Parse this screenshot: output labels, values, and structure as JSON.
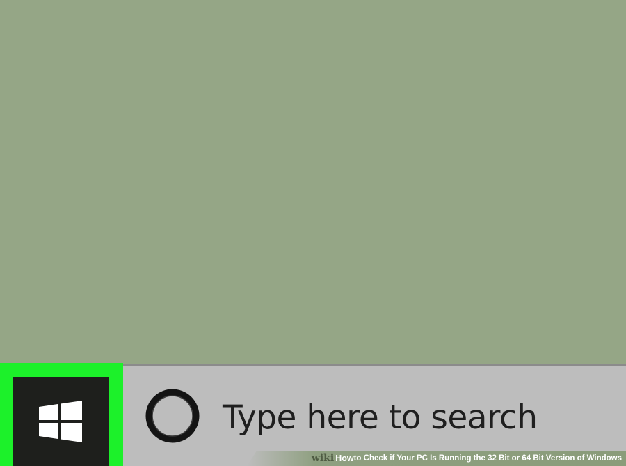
{
  "desktop": {
    "background_color": "#95a686"
  },
  "start_button": {
    "icon": "windows-logo-icon",
    "highlight_color": "#1cf12a",
    "button_color": "#1e1f1c"
  },
  "search": {
    "icon": "cortana-circle-icon",
    "placeholder": "Type here to search"
  },
  "watermark": {
    "logo": "wiki",
    "title_emphasis": "How",
    "title_rest": " to Check if Your PC Is Running the 32 Bit or 64 Bit Version of Windows"
  }
}
